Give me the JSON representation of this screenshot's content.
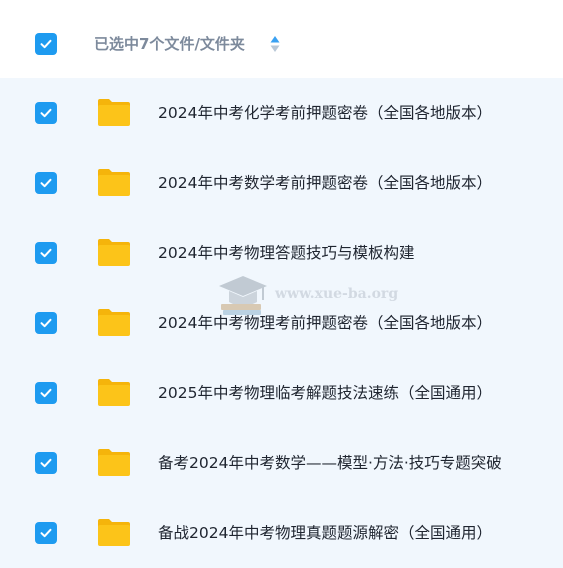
{
  "header": {
    "select_all_checked": true,
    "label": "已选中7个文件/文件夹",
    "sort_icon": "sort-updown-icon"
  },
  "items": [
    {
      "name": "2024年中考化学考前押题密卷（全国各地版本）",
      "checked": true,
      "icon": "folder-icon"
    },
    {
      "name": "2024年中考数学考前押题密卷（全国各地版本）",
      "checked": true,
      "icon": "folder-icon"
    },
    {
      "name": "2024年中考物理答题技巧与模板构建",
      "checked": true,
      "icon": "folder-icon"
    },
    {
      "name": "2024年中考物理考前押题密卷（全国各地版本）",
      "checked": true,
      "icon": "folder-icon"
    },
    {
      "name": "2025年中考物理临考解题技法速练（全国通用）",
      "checked": true,
      "icon": "folder-icon"
    },
    {
      "name": "备考2024年中考数学——模型·方法·技巧专题突破",
      "checked": true,
      "icon": "folder-icon"
    },
    {
      "name": "备战2024年中考物理真题题源解密（全国通用）",
      "checked": true,
      "icon": "folder-icon"
    }
  ],
  "watermark": {
    "text": "www.xue-ba.org",
    "icon": "graduation-cap-icon"
  },
  "colors": {
    "checkbox": "#1e9bf0",
    "folder": "#fcc419",
    "list_background": "#f1f7fd",
    "header_text": "#7d8a9c"
  }
}
